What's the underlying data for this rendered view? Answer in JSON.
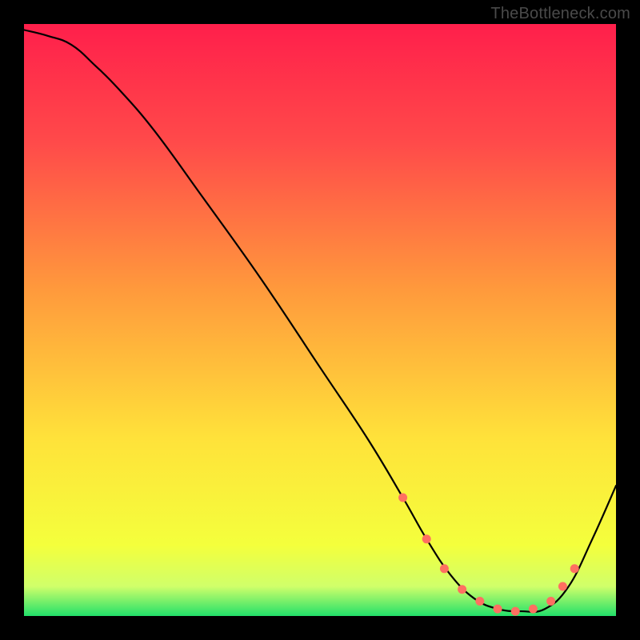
{
  "watermark": "TheBottleneck.com",
  "chart_data": {
    "type": "line",
    "title": "",
    "xlabel": "",
    "ylabel": "",
    "xlim": [
      0,
      100
    ],
    "ylim": [
      0,
      100
    ],
    "gradient_stops": [
      {
        "offset": 0,
        "color": "#ff1f4b"
      },
      {
        "offset": 0.2,
        "color": "#ff4a4a"
      },
      {
        "offset": 0.45,
        "color": "#ff9a3c"
      },
      {
        "offset": 0.7,
        "color": "#ffe23a"
      },
      {
        "offset": 0.88,
        "color": "#f4ff3c"
      },
      {
        "offset": 0.95,
        "color": "#d0ff6a"
      },
      {
        "offset": 1.0,
        "color": "#22e06a"
      }
    ],
    "series": [
      {
        "name": "bottleneck-curve",
        "color": "#000000",
        "x": [
          0,
          4,
          8,
          12,
          16,
          22,
          30,
          40,
          50,
          58,
          64,
          68,
          72,
          76,
          80,
          84,
          88,
          92,
          96,
          100
        ],
        "y": [
          99,
          98,
          96.5,
          93,
          89,
          82,
          71,
          57,
          42,
          30,
          20,
          13,
          7,
          3,
          1.2,
          0.8,
          1.2,
          5,
          13,
          22
        ]
      }
    ],
    "markers": {
      "name": "highlight-dots",
      "color": "#ff6f61",
      "radius": 5.5,
      "x": [
        64,
        68,
        71,
        74,
        77,
        80,
        83,
        86,
        89,
        91,
        93
      ],
      "y": [
        20,
        13,
        8,
        4.5,
        2.5,
        1.2,
        0.8,
        1.2,
        2.5,
        5,
        8
      ]
    }
  }
}
